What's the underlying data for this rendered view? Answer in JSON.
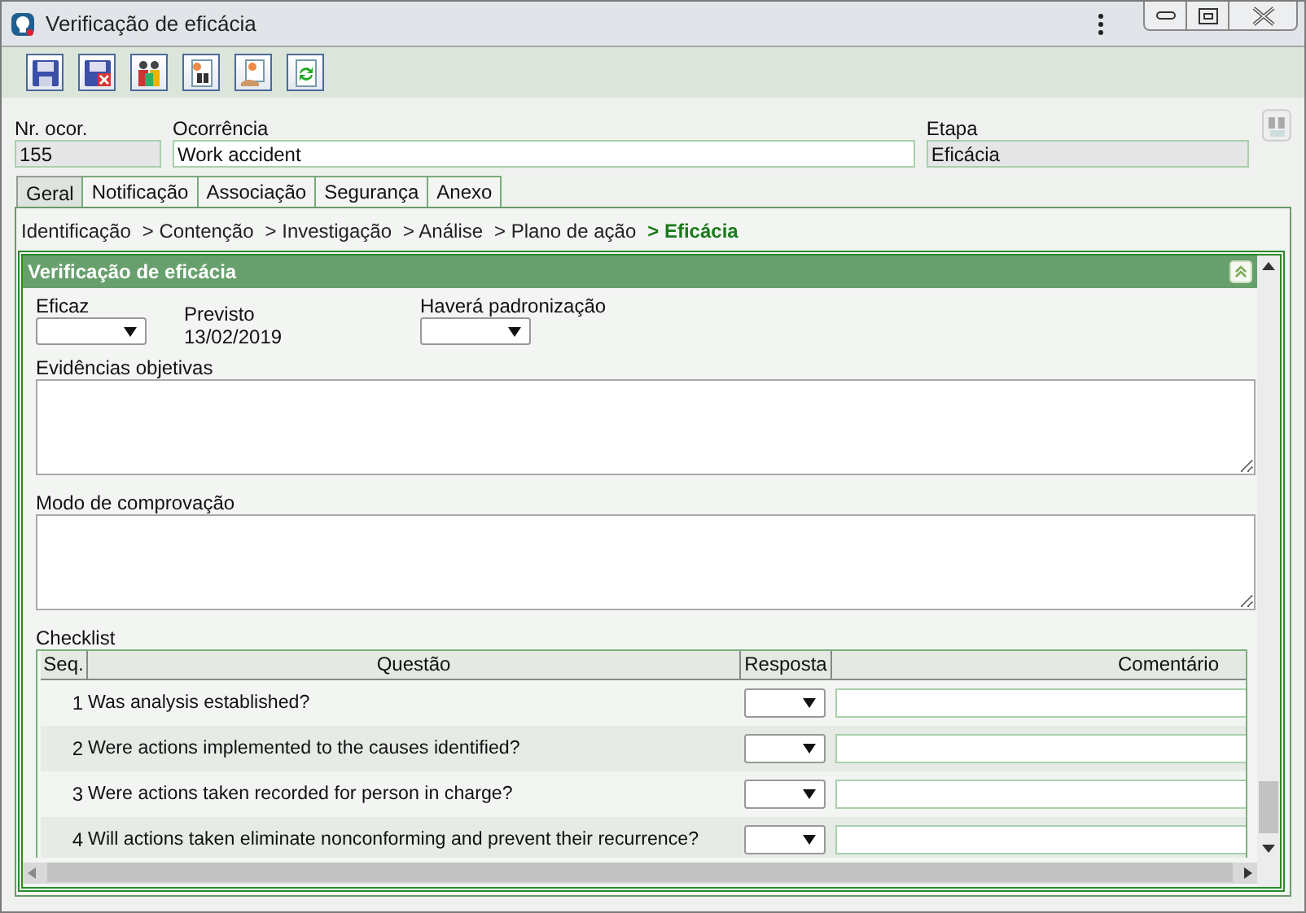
{
  "window": {
    "title": "Verificação de eficácia"
  },
  "header_fields": [
    {
      "label": "Nr. ocor.",
      "value": "155",
      "disabled": true
    },
    {
      "label": "Ocorrência",
      "value": "Work accident",
      "disabled": false
    },
    {
      "label": "Etapa",
      "value": "Eficácia",
      "disabled": true
    }
  ],
  "tabs": [
    {
      "label": "Geral",
      "selected": true
    },
    {
      "label": "Notificação",
      "selected": false
    },
    {
      "label": "Associação",
      "selected": false
    },
    {
      "label": "Segurança",
      "selected": false
    },
    {
      "label": "Anexo",
      "selected": false
    }
  ],
  "breadcrumb": [
    {
      "label": "Identificação",
      "selected": false
    },
    {
      "label": "> Contenção",
      "selected": false
    },
    {
      "label": "> Investigação",
      "selected": false
    },
    {
      "label": "> Análise",
      "selected": false
    },
    {
      "label": "> Plano de ação",
      "selected": false
    },
    {
      "label": "> Eficácia",
      "selected": true
    }
  ],
  "section": {
    "title": "Verificação de eficácia",
    "expanded": true,
    "eficaz": {
      "label": "Eficaz"
    },
    "previsto": {
      "label": "Previsto",
      "value": "13/02/2019"
    },
    "padronizacao": {
      "label": "Haverá padronização"
    },
    "evidencias": {
      "label": "Evidências objetivas"
    },
    "modo": {
      "label": "Modo de comprovação"
    },
    "checklist": {
      "label": "Checklist",
      "columns": [
        "Seq.",
        "Questão",
        "Resposta",
        "Comentário"
      ],
      "rows": [
        {
          "seq": "1",
          "question": "Was analysis established?"
        },
        {
          "seq": "2",
          "question": "Were actions implemented to the causes identified?"
        },
        {
          "seq": "3",
          "question": "Were actions taken recorded for person in charge?"
        },
        {
          "seq": "4",
          "question": "Will actions taken eliminate nonconforming and prevent their recurrence?"
        }
      ]
    }
  }
}
